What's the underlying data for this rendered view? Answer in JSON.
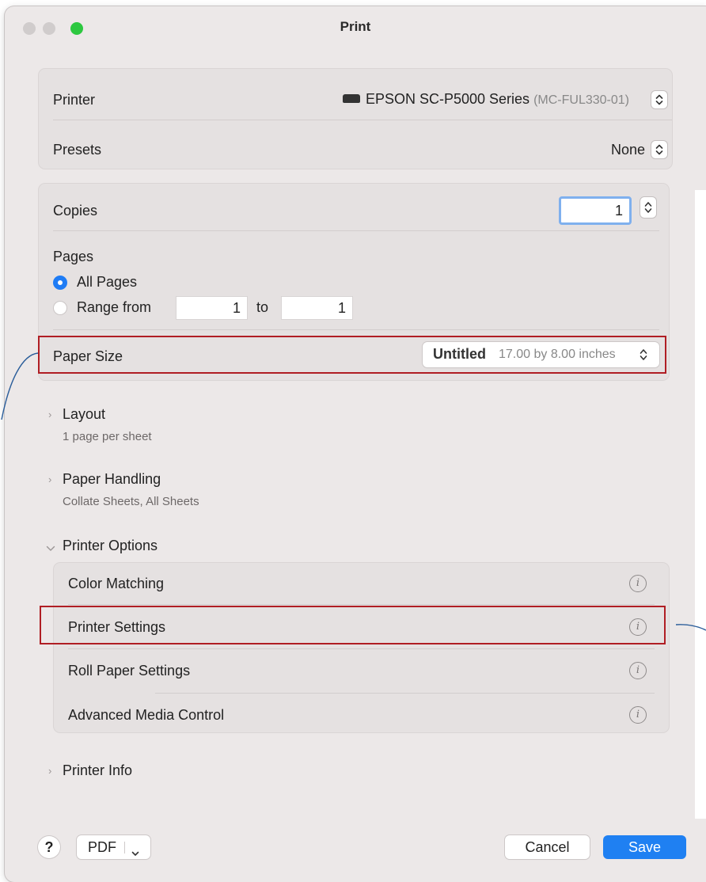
{
  "window": {
    "title": "Print"
  },
  "printer_group": {
    "printer_label": "Printer",
    "printer_name": "EPSON SC-P5000 Series",
    "printer_id": "(MC-FUL330-01)",
    "presets_label": "Presets",
    "presets_value": "None"
  },
  "copies_group": {
    "copies_label": "Copies",
    "copies_value": "1",
    "pages_label": "Pages",
    "all_pages_label": "All Pages",
    "range_from_label": "Range from",
    "range_from_value": "1",
    "range_to_label": "to",
    "range_to_value": "1",
    "paper_size_label": "Paper Size",
    "paper_size_value": "Untitled",
    "paper_size_dims": "17.00 by 8.00 inches"
  },
  "sections": {
    "layout_title": "Layout",
    "layout_sub": "1 page per sheet",
    "paper_handling_title": "Paper Handling",
    "paper_handling_sub": "Collate Sheets, All Sheets",
    "printer_options_title": "Printer Options",
    "printer_info_title": "Printer Info"
  },
  "printer_options": {
    "items": [
      {
        "label": "Color Matching"
      },
      {
        "label": "Printer Settings"
      },
      {
        "label": "Roll Paper Settings"
      },
      {
        "label": "Advanced Media Control"
      }
    ]
  },
  "footer": {
    "help_label": "?",
    "pdf_label": "PDF",
    "cancel_label": "Cancel",
    "save_label": "Save"
  },
  "colors": {
    "accent": "#1f80f2",
    "highlight": "#b01e24",
    "callout_line": "#2a5d9a"
  },
  "icons": [
    "printer-icon",
    "updown-chevron-icon",
    "info-icon",
    "chevron-right-icon",
    "chevron-down-icon",
    "help-icon"
  ]
}
